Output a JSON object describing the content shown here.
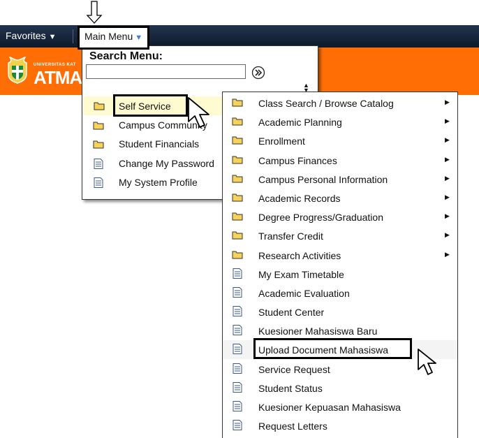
{
  "navbar": {
    "favorites_label": "Favorites",
    "main_menu_label": "Main Menu",
    "dropdown_glyph": "▼"
  },
  "logo": {
    "small_text": "UNIVERSITAS KAT",
    "big_text": "ATMA"
  },
  "main_menu": {
    "search_title": "Search Menu:",
    "search_value": "",
    "items": [
      {
        "label": "Self Service",
        "icon": "folder-icon",
        "active": true
      },
      {
        "label": "Campus Community",
        "icon": "folder-icon"
      },
      {
        "label": "Student Financials",
        "icon": "folder-icon"
      },
      {
        "label": "Change My Password",
        "icon": "document-icon"
      },
      {
        "label": "My System Profile",
        "icon": "document-icon"
      }
    ]
  },
  "self_service_menu": {
    "items": [
      {
        "label": "Class Search / Browse Catalog",
        "icon": "folder-icon",
        "has_submenu": true
      },
      {
        "label": "Academic Planning",
        "icon": "folder-icon",
        "has_submenu": true
      },
      {
        "label": "Enrollment",
        "icon": "folder-icon",
        "has_submenu": true
      },
      {
        "label": "Campus Finances",
        "icon": "folder-icon",
        "has_submenu": true
      },
      {
        "label": "Campus Personal Information",
        "icon": "folder-icon",
        "has_submenu": true
      },
      {
        "label": "Academic Records",
        "icon": "folder-icon",
        "has_submenu": true
      },
      {
        "label": "Degree Progress/Graduation",
        "icon": "folder-icon",
        "has_submenu": true
      },
      {
        "label": "Transfer Credit",
        "icon": "folder-icon",
        "has_submenu": true
      },
      {
        "label": "Research Activities",
        "icon": "folder-icon",
        "has_submenu": true
      },
      {
        "label": "My Exam Timetable",
        "icon": "document-icon"
      },
      {
        "label": "Academic Evaluation",
        "icon": "document-icon"
      },
      {
        "label": "Student Center",
        "icon": "document-icon"
      },
      {
        "label": "Kuesioner Mahasiswa Baru",
        "icon": "document-icon"
      },
      {
        "label": "Upload Document Mahasiswa",
        "icon": "document-icon",
        "highlighted": true
      },
      {
        "label": "Service Request",
        "icon": "document-icon"
      },
      {
        "label": "Student Status",
        "icon": "document-icon"
      },
      {
        "label": "Kuesioner Kepuasan Mahasiswa",
        "icon": "document-icon"
      },
      {
        "label": "Request Letters",
        "icon": "document-icon"
      }
    ]
  },
  "colors": {
    "navbar": "#1a2a42",
    "header_orange": "#ff6e05",
    "active_row": "#fffbd0",
    "folder": "#f7d25a",
    "highlight_border": "#000000"
  }
}
